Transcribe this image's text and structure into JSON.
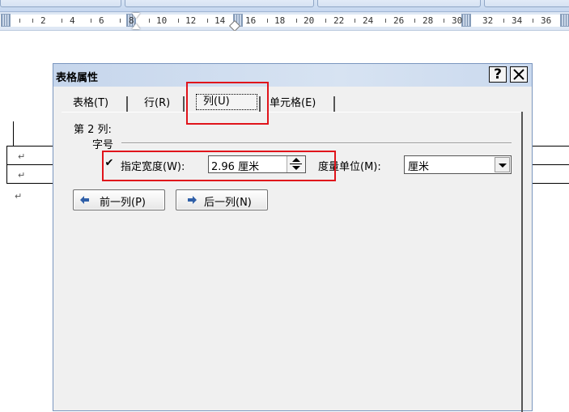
{
  "dialog": {
    "title": "表格属性",
    "help_label": "?",
    "close_label": "✕",
    "tabs": [
      {
        "label": "表格(T)"
      },
      {
        "label": "行(R)"
      },
      {
        "label": "列(U)"
      },
      {
        "label": "单元格(E)"
      }
    ],
    "active_tab": "列(U)",
    "column_heading": "第 2 列:",
    "group_label": "字号",
    "specify_width": {
      "checked": true,
      "label": "指定宽度(W):",
      "value": "2.96 厘米"
    },
    "measure_unit": {
      "label": "度量单位(M):",
      "value": "厘米"
    },
    "prev_column_label": "前一列(P)",
    "next_column_label": "后一列(N)"
  },
  "ruler": {
    "numbers": [
      "2",
      "4",
      "6",
      "8",
      "10",
      "12",
      "14",
      "16",
      "18",
      "20",
      "22",
      "24",
      "26",
      "28",
      "30",
      "32",
      "34",
      "36"
    ]
  },
  "document": {
    "paragraph_mark": "↵"
  },
  "colors": {
    "annotation": "#e0141b",
    "titlebar": "#c6d6ec",
    "ruler_margin": "#9db7d8"
  },
  "icons": {
    "prev": "arrow-left-icon",
    "next": "arrow-right-icon"
  }
}
